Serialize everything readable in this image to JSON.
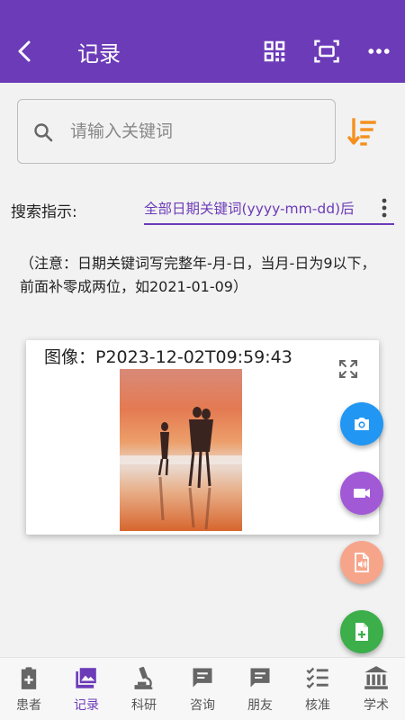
{
  "app_bar": {
    "title": "记录",
    "icons": [
      "back-arrow-icon",
      "qr-code-icon",
      "scan-icon",
      "more-horizontal-icon"
    ]
  },
  "search": {
    "placeholder": "请输入关键词",
    "value": ""
  },
  "search_hint": {
    "label": "搜索指示:",
    "selected": "全部日期关键词(yyyy-mm-dd)后"
  },
  "note": "（注意：日期关键词写完整年-月-日，当月-日为9以下，前面补零成两位，如2021-01-09）",
  "record_card": {
    "caption": "图像：P2023-12-02T09:59:43"
  },
  "fabs": [
    {
      "icon": "camera-icon",
      "color": "#2196f3"
    },
    {
      "icon": "video-camera-icon",
      "color": "#a259d6"
    },
    {
      "icon": "audio-file-icon",
      "color": "#f6a58b"
    },
    {
      "icon": "add-file-icon",
      "color": "#3cae4a"
    }
  ],
  "bottom_nav": {
    "active": 1,
    "items": [
      {
        "label": "患者",
        "icon": "clipboard-plus-icon"
      },
      {
        "label": "记录",
        "icon": "image-gallery-icon"
      },
      {
        "label": "科研",
        "icon": "microscope-icon"
      },
      {
        "label": "咨询",
        "icon": "chat-icon"
      },
      {
        "label": "朋友",
        "icon": "chat-icon"
      },
      {
        "label": "核准",
        "icon": "checklist-icon"
      },
      {
        "label": "学术",
        "icon": "institution-icon"
      }
    ]
  },
  "colors": {
    "primary": "#6c3bb8",
    "sort_icon": "#f5901e"
  }
}
